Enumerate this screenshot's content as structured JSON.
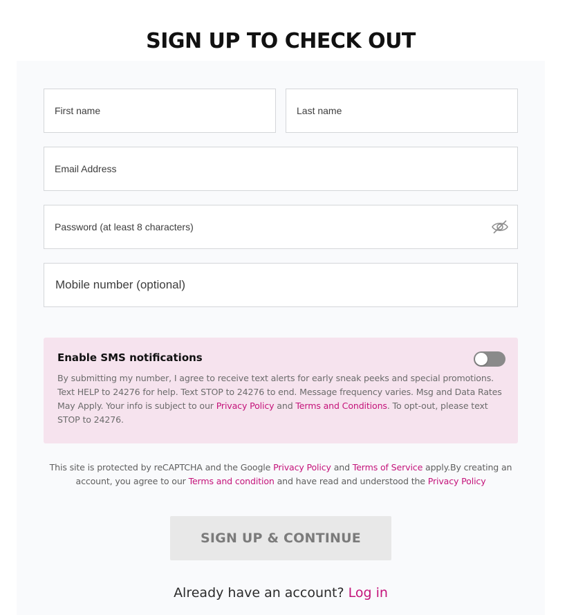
{
  "page": {
    "title": "SIGN UP TO CHECK OUT"
  },
  "form": {
    "first_name": {
      "value": "",
      "placeholder": "First name"
    },
    "last_name": {
      "value": "",
      "placeholder": "Last name"
    },
    "email": {
      "value": "",
      "placeholder": "Email Address"
    },
    "password": {
      "value": "",
      "placeholder": "Password (at least 8 characters)",
      "toggle_icon": "eye-slash-icon"
    },
    "mobile": {
      "value": "",
      "placeholder": "Mobile number (optional)"
    }
  },
  "sms": {
    "title": "Enable SMS notifications",
    "toggle_on": false,
    "body_1": "By submitting my number, I agree to receive text alerts for early sneak peeks and special promotions. Text HELP to 24276 for help. Text STOP to 24276 to end. Message frequency varies. Msg and Data Rates May Apply. Your info is subject to our ",
    "privacy_link": "Privacy Policy",
    "and": " and ",
    "terms_link": "Terms and Conditions",
    "body_2": ". To opt-out, please text STOP to 24276."
  },
  "recaptcha": {
    "text_1": "This site is protected by reCAPTCHA and the Google ",
    "privacy_link": "Privacy Policy",
    "text_2": " and ",
    "tos_link": "Terms of Service",
    "text_3": " apply.By creating an account, you agree to our ",
    "terms_link": "Terms and condition",
    "text_4": " and have read and understood the ",
    "privacy_link_2": "Privacy Policy"
  },
  "actions": {
    "submit_label": "SIGN UP & CONTINUE",
    "login_prompt": "Already have an account? ",
    "login_link": "Log in"
  },
  "colors": {
    "accent": "#c4137a",
    "sms_background": "#f6e3ee",
    "panel_background": "#f9fafc",
    "button_disabled": "#e8e8e8"
  }
}
